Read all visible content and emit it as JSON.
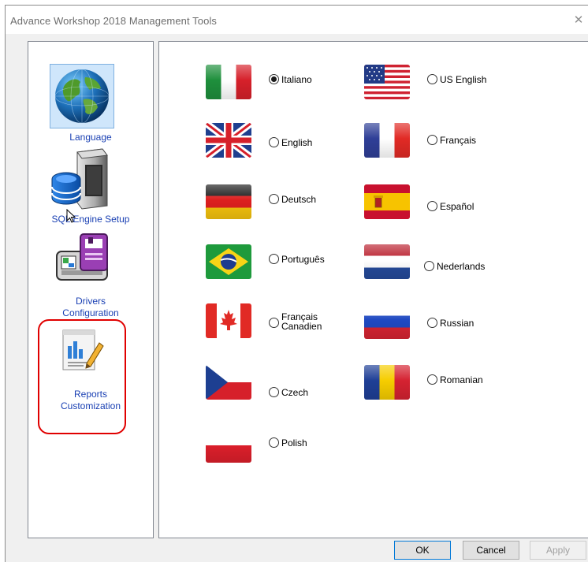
{
  "window": {
    "title": "Advance Workshop 2018 Management Tools",
    "close_glyph": "✕"
  },
  "sidebar": {
    "items": [
      {
        "label": "Language",
        "icon": "globe-icon"
      },
      {
        "label": "SQL Engine Setup",
        "icon": "database-server-icon"
      },
      {
        "label": "Drivers Configuration",
        "icon": "drivers-printer-icon"
      },
      {
        "label": "Reports Customization",
        "icon": "reports-chart-icon"
      }
    ]
  },
  "languages": {
    "selected": "Italiano",
    "left_column": [
      {
        "label": "Italiano",
        "flag": "italy-flag",
        "checked": true
      },
      {
        "label": "English",
        "flag": "uk-flag",
        "checked": false
      },
      {
        "label": "Deutsch",
        "flag": "germany-flag",
        "checked": false
      },
      {
        "label": "Português",
        "flag": "brazil-flag",
        "checked": false
      },
      {
        "label": "Français\nCanadien",
        "flag": "canada-flag",
        "checked": false
      },
      {
        "label": "Czech",
        "flag": "czech-flag",
        "checked": false
      },
      {
        "label": "Polish",
        "flag": "poland-flag",
        "checked": false
      }
    ],
    "right_column": [
      {
        "label": "US English",
        "flag": "usa-flag",
        "checked": false
      },
      {
        "label": "Français",
        "flag": "france-flag",
        "checked": false
      },
      {
        "label": "Español",
        "flag": "spain-flag",
        "checked": false
      },
      {
        "label": "Nederlands",
        "flag": "netherlands-flag",
        "checked": false
      },
      {
        "label": "Russian",
        "flag": "russia-flag",
        "checked": false
      },
      {
        "label": "Romanian",
        "flag": "romania-flag",
        "checked": false
      }
    ]
  },
  "buttons": {
    "ok": "OK",
    "cancel": "Cancel",
    "apply": "Apply"
  },
  "colors": {
    "nav_label": "#1a40b3",
    "highlight_ring": "#e00000"
  }
}
